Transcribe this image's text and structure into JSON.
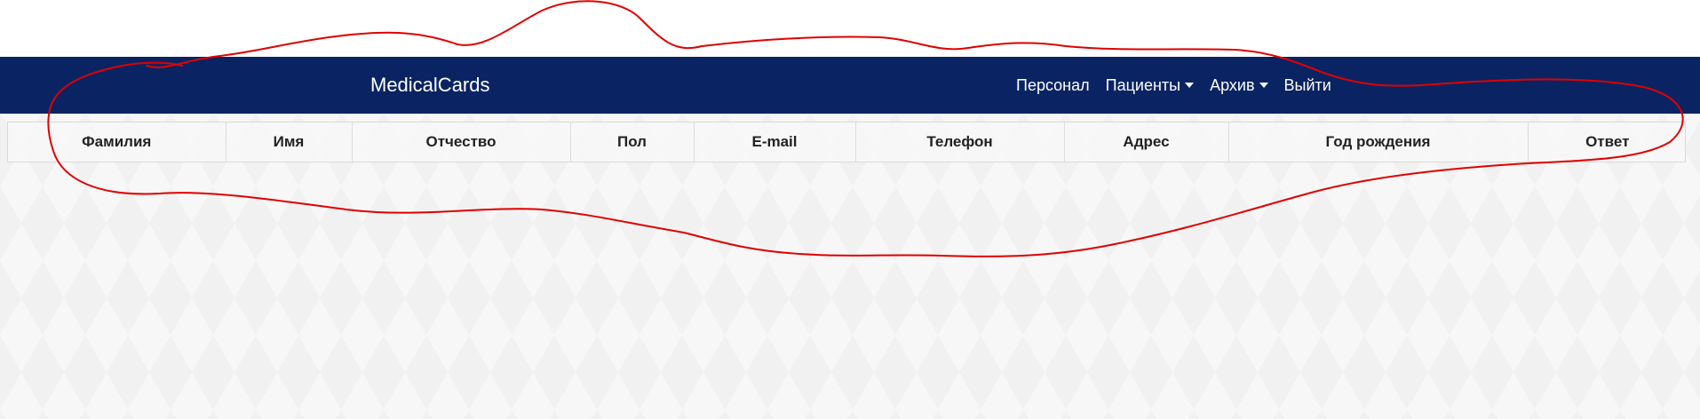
{
  "navbar": {
    "brand": "MedicalCards",
    "items": [
      {
        "label": "Персонал",
        "dropdown": false
      },
      {
        "label": "Пациенты",
        "dropdown": true
      },
      {
        "label": "Архив",
        "dropdown": true
      },
      {
        "label": "Выйти",
        "dropdown": false
      }
    ]
  },
  "table": {
    "headers": [
      "Фамилия",
      "Имя",
      "Отчество",
      "Пол",
      "E-mail",
      "Телефон",
      "Адрес",
      "Год рождения",
      "Ответ"
    ]
  },
  "colors": {
    "navbar_bg": "#0a2463",
    "annotation": "#e00000"
  }
}
